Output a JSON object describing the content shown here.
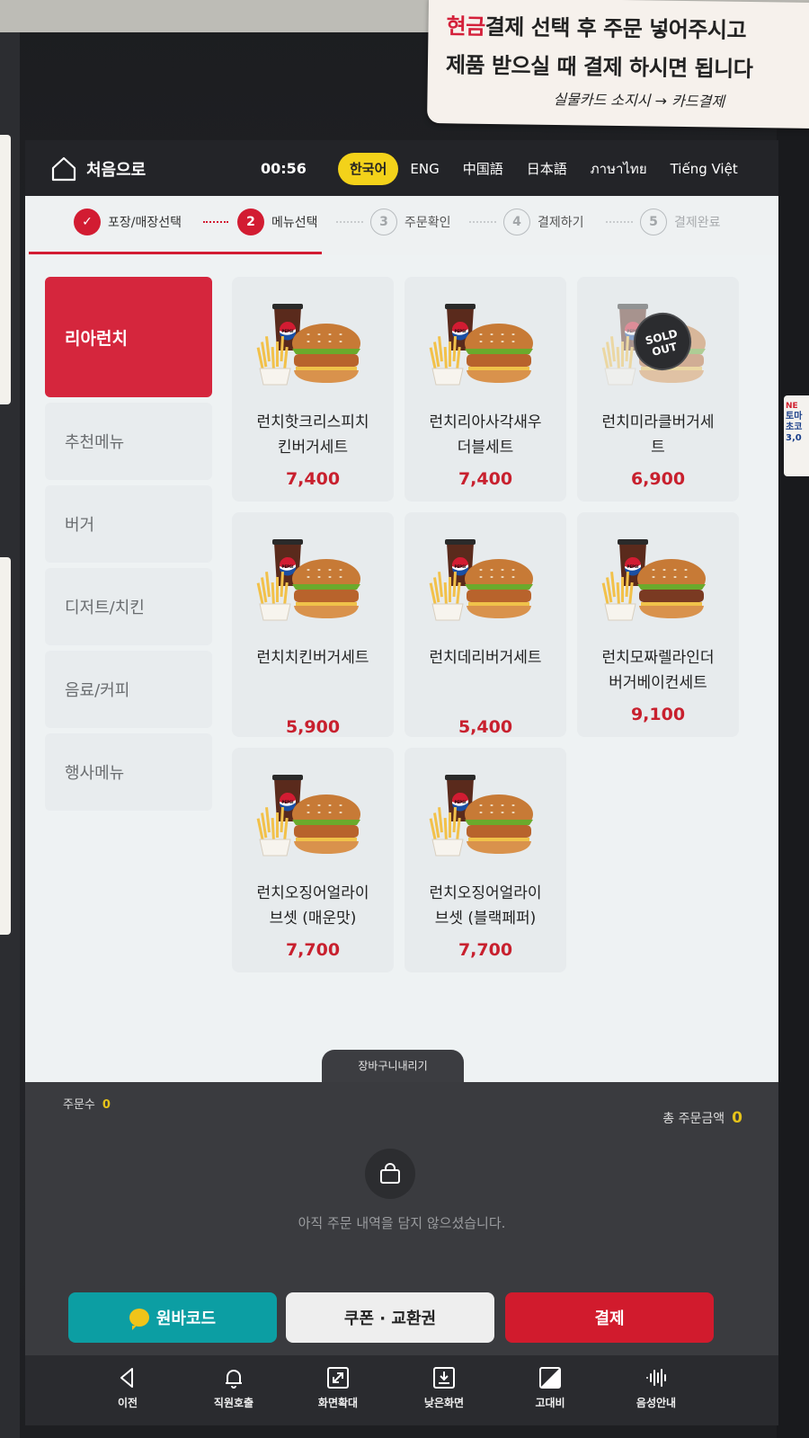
{
  "notice": {
    "highlight": "현금",
    "line1_rest": "결제 선택 후 주문 넣어주시고",
    "line2": "제품 받으실 때 결제 하시면 됩니다",
    "line3": "실물카드 소지시 → 카드결제"
  },
  "side_tag": {
    "line1": "NE",
    "line2": "토마",
    "line3": "초코",
    "line4": "3,0"
  },
  "topbar": {
    "home_label": "처음으로",
    "timer": "00:56",
    "languages": [
      {
        "label": "한국어",
        "active": true
      },
      {
        "label": "ENG",
        "active": false
      },
      {
        "label": "中国語",
        "active": false
      },
      {
        "label": "日本語",
        "active": false
      },
      {
        "label": "ภาษาไทย",
        "active": false
      },
      {
        "label": "Tiếng Việt",
        "active": false
      }
    ]
  },
  "steps": [
    {
      "num": "✓",
      "label": "포장/매장선택",
      "state": "done"
    },
    {
      "num": "2",
      "label": "메뉴선택",
      "state": "current"
    },
    {
      "num": "3",
      "label": "주문확인",
      "state": "todo"
    },
    {
      "num": "4",
      "label": "결제하기",
      "state": "todo"
    },
    {
      "num": "5",
      "label": "결제완료",
      "state": "faded"
    }
  ],
  "categories": [
    {
      "label": "리아런치",
      "active": true
    },
    {
      "label": "추천메뉴",
      "active": false
    },
    {
      "label": "버거",
      "active": false
    },
    {
      "label": "디저트/치킨",
      "active": false
    },
    {
      "label": "음료/커피",
      "active": false
    },
    {
      "label": "행사메뉴",
      "active": false
    }
  ],
  "menu_items": [
    {
      "name": "런치핫크리스피치킨버거세트",
      "price": "7,400",
      "sold_out": false
    },
    {
      "name": "런치리아사각새우더블세트",
      "price": "7,400",
      "sold_out": false
    },
    {
      "name": "런치미라클버거세트",
      "price": "6,900",
      "sold_out": true
    },
    {
      "name": "런치치킨버거세트",
      "price": "5,900",
      "sold_out": false
    },
    {
      "name": "런치데리버거세트",
      "price": "5,400",
      "sold_out": false
    },
    {
      "name": "런치모짜렐라인더버거베이컨세트",
      "price": "9,100",
      "sold_out": false
    },
    {
      "name": "런치오징어얼라이브셋 (매운맛)",
      "price": "7,700",
      "sold_out": false
    },
    {
      "name": "런치오징어얼라이브셋 (블랙페퍼)",
      "price": "7,700",
      "sold_out": false
    }
  ],
  "menu_lines": {
    "m1": [
      "런치핫크리스피치",
      "킨버거세트"
    ],
    "m2": [
      "런치리아사각새우",
      "더블세트"
    ],
    "m3": [
      "런치미라클버거세",
      "트"
    ],
    "m4": [
      "런치치킨버거세트"
    ],
    "m5": [
      "런치데리버거세트"
    ],
    "m6": [
      "런치모짜렐라인더",
      "버거베이컨세트"
    ],
    "m7": [
      "런치오징어얼라이",
      "브셋 (매운맛)"
    ],
    "m8": [
      "런치오징어얼라이",
      "브셋 (블랙페퍼)"
    ]
  },
  "sold_out_label": [
    "SOLD",
    "OUT"
  ],
  "cup_brand": "PEPSI",
  "cart": {
    "tab_label": "장바구니내리기",
    "count_label": "주문수",
    "count_value": "0",
    "total_label": "총 주문금액",
    "total_value": "0",
    "empty_message": "아직 주문 내역을 담지 않으셨습니다."
  },
  "buttons": {
    "barcode": "원바코드",
    "coupon": "쿠폰 · 교환권",
    "pay": "결제"
  },
  "bottom_nav": [
    {
      "label": "이전",
      "icon": "back-icon"
    },
    {
      "label": "직원호출",
      "icon": "bell-icon"
    },
    {
      "label": "화면확대",
      "icon": "expand-icon"
    },
    {
      "label": "낮은화면",
      "icon": "low-screen-icon"
    },
    {
      "label": "고대비",
      "icon": "contrast-icon"
    },
    {
      "label": "음성안내",
      "icon": "voice-icon"
    }
  ],
  "colors": {
    "brand_red": "#d21c32",
    "language_highlight": "#f3d21a",
    "barcode_teal": "#0c9ea3",
    "price_red": "#c8202e"
  }
}
